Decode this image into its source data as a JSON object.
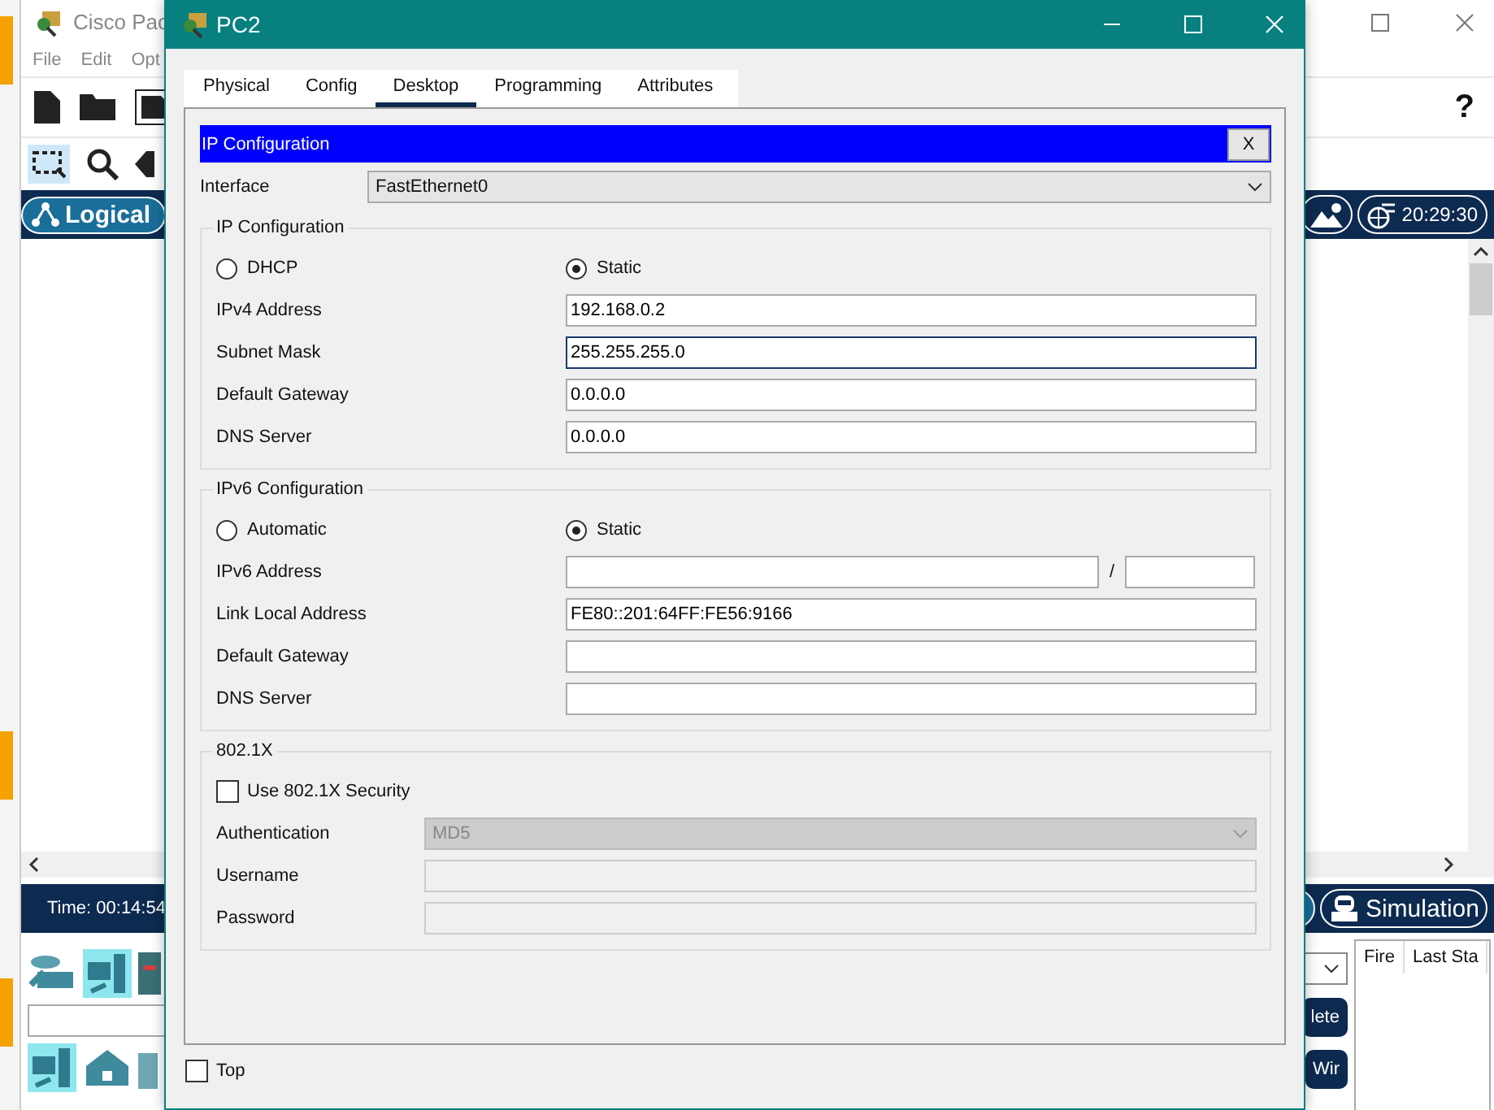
{
  "background_app": {
    "title": "Cisco Pac",
    "menu": [
      "File",
      "Edit",
      "Opt"
    ],
    "help": "?",
    "logical_button": "Logical",
    "clock": "20:29:30",
    "time": "Time: 00:14:54",
    "simulation_button": "Simulation",
    "side_buttons": [
      "lete",
      "Wir"
    ],
    "event_table": {
      "columns": [
        "Fire",
        "Last Sta"
      ]
    }
  },
  "dialog": {
    "title": "PC2",
    "tabs": [
      {
        "label": "Physical",
        "selected": false
      },
      {
        "label": "Config",
        "selected": false
      },
      {
        "label": "Desktop",
        "selected": true
      },
      {
        "label": "Programming",
        "selected": false
      },
      {
        "label": "Attributes",
        "selected": false
      }
    ],
    "panel_title": "IP Configuration",
    "close_label": "X",
    "interface": {
      "label": "Interface",
      "value": "FastEthernet0"
    },
    "groups": [
      {
        "title": "IP Configuration",
        "modes": [
          {
            "label": "DHCP",
            "selected": false
          },
          {
            "label": "Static",
            "selected": true
          }
        ],
        "fields": [
          {
            "label": "IPv4 Address",
            "kind": "text",
            "value": "192.168.0.2",
            "focused": false
          },
          {
            "label": "Subnet Mask",
            "kind": "text",
            "value": "255.255.255.0",
            "focused": true
          },
          {
            "label": "Default Gateway",
            "kind": "text",
            "value": "0.0.0.0",
            "focused": false
          },
          {
            "label": "DNS Server",
            "kind": "text",
            "value": "0.0.0.0",
            "focused": false
          }
        ]
      },
      {
        "title": "IPv6 Configuration",
        "modes": [
          {
            "label": "Automatic",
            "selected": false
          },
          {
            "label": "Static",
            "selected": true
          }
        ],
        "fields": [
          {
            "label": "IPv6 Address",
            "kind": "prefix",
            "separator": "/",
            "focused": false
          },
          {
            "label": "Link Local Address",
            "kind": "text",
            "value": "FE80::201:64FF:FE56:9166",
            "focused": false
          },
          {
            "label": "Default Gateway",
            "kind": "text",
            "focused": false
          },
          {
            "label": "DNS Server",
            "kind": "text",
            "focused": false
          }
        ]
      },
      {
        "title": "802.1X",
        "checkbox": {
          "label": "Use 802.1X Security",
          "checked": false
        },
        "fields": [
          {
            "label": "Authentication",
            "kind": "select",
            "value": "MD5",
            "disabled": true
          },
          {
            "label": "Username",
            "kind": "text",
            "disabled": true
          },
          {
            "label": "Password",
            "kind": "text",
            "disabled": true
          }
        ]
      }
    ],
    "top": {
      "label": "Top",
      "checked": false
    }
  }
}
